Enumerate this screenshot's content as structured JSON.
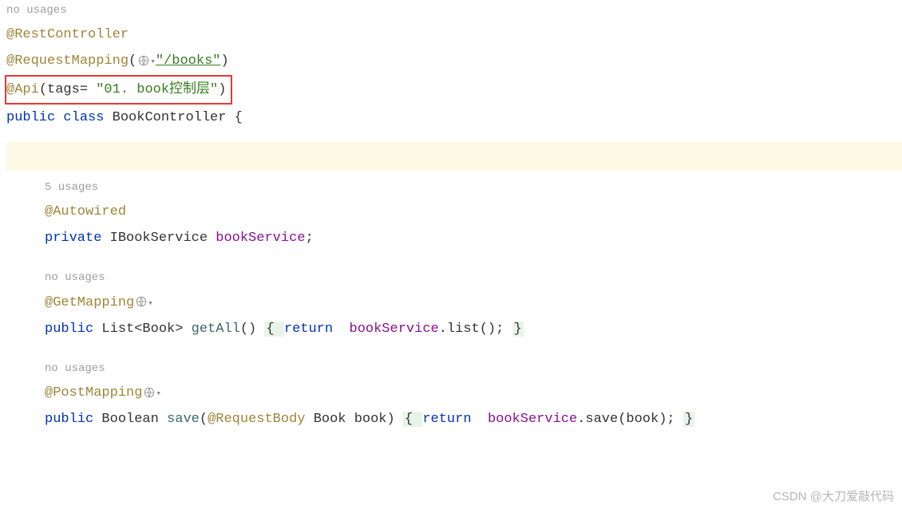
{
  "hints": {
    "noUsages": "no usages",
    "usages5": "5 usages"
  },
  "line1": {
    "anno": "@RestController"
  },
  "line2": {
    "anno": "@RequestMapping",
    "open": "(",
    "str": "\"/books\"",
    "close": ")"
  },
  "line3": {
    "anno": "@Api",
    "tagsPart": "(tags= ",
    "str": "\"01. book控制层\"",
    "close": ")"
  },
  "line4": {
    "kwPublic": "public ",
    "kwClass": "class ",
    "name": "BookController ",
    "brace": "{"
  },
  "autowired": {
    "anno": "@Autowired",
    "kwPrivate": "private ",
    "type": "IBookService ",
    "field": "bookService",
    "semi": ";"
  },
  "getMapping": {
    "anno": "@GetMapping",
    "kwPublic": "public ",
    "retType": "List<Book> ",
    "method": "getAll",
    "parens": "() ",
    "foldOpen": "{ ",
    "kwReturn": "return ",
    "obj": "bookService",
    "dot": ".",
    "call": "list",
    "callParens": "(); ",
    "foldClose": "}"
  },
  "postMapping": {
    "anno": "@PostMapping",
    "kwPublic": "public ",
    "retType": "Boolean ",
    "method": "save",
    "open": "(",
    "paramAnno": "@RequestBody ",
    "paramType": "Book ",
    "paramName": "book",
    "close": ") ",
    "foldOpen": "{ ",
    "kwReturn": "return ",
    "obj": "bookService",
    "dot": ".",
    "call": "save",
    "callOpen": "(",
    "arg": "book",
    "callClose": "); ",
    "foldClose": "}"
  },
  "watermark": "CSDN @大刀爱敲代码"
}
